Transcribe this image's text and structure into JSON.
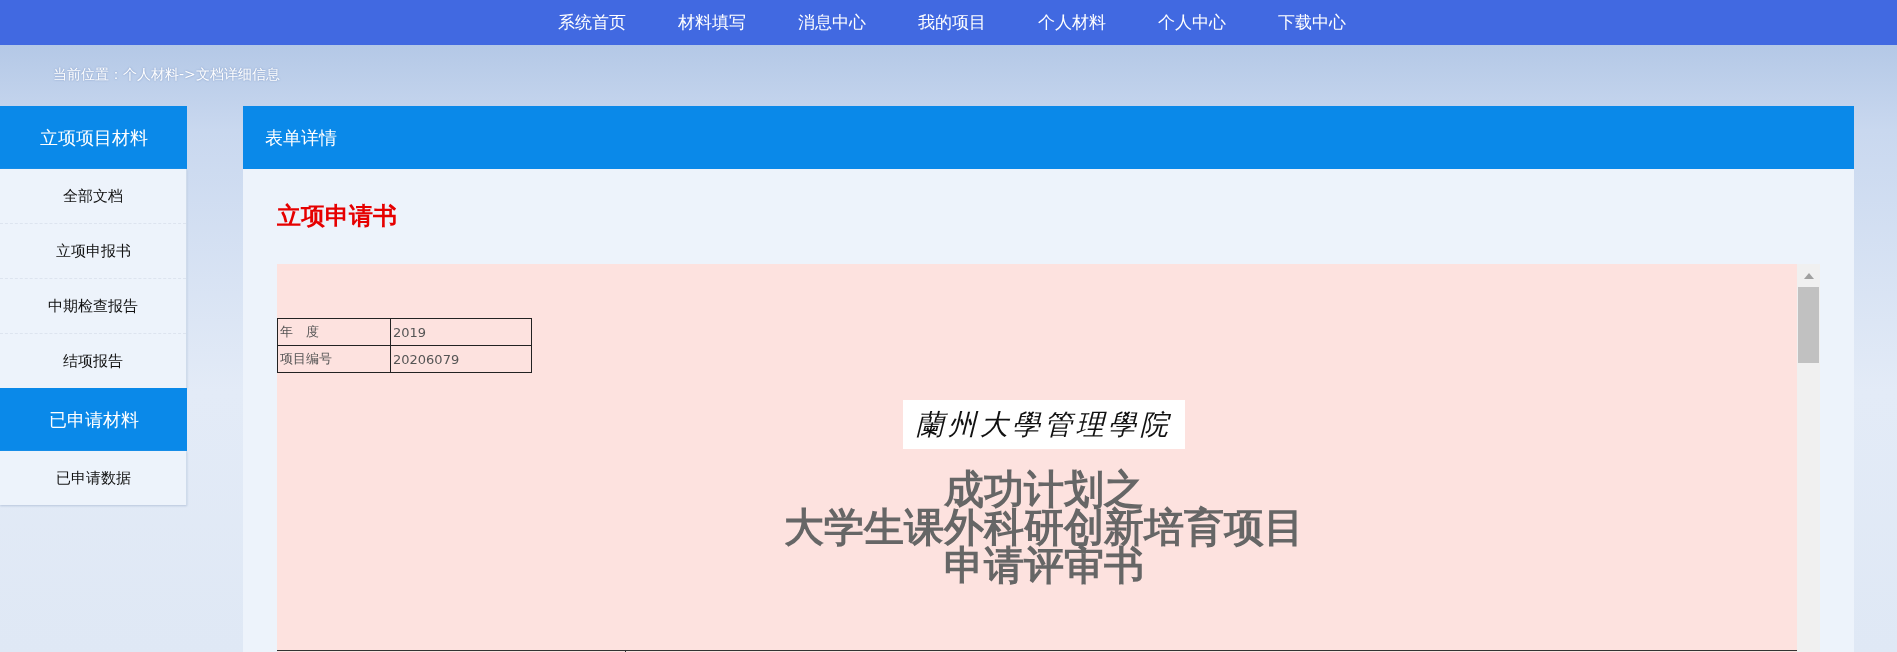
{
  "nav": {
    "items": [
      {
        "label": "系统首页"
      },
      {
        "label": "材料填写"
      },
      {
        "label": "消息中心"
      },
      {
        "label": "我的项目"
      },
      {
        "label": "个人材料"
      },
      {
        "label": "个人中心"
      },
      {
        "label": "下载中心"
      }
    ]
  },
  "breadcrumb": "当前位置：个人材料->文档详细信息",
  "sidebar": {
    "groups": [
      {
        "title": "立项项目材料",
        "items": [
          {
            "label": "全部文档"
          },
          {
            "label": "立项申报书"
          },
          {
            "label": "中期检查报告"
          },
          {
            "label": "结项报告"
          }
        ]
      },
      {
        "title": "已申请材料",
        "items": [
          {
            "label": "已申请数据"
          }
        ]
      }
    ]
  },
  "panel": {
    "title": "表单详情",
    "doc_title": "立项申请书",
    "document": {
      "info_rows": [
        {
          "label": "年　度",
          "value": "2019"
        },
        {
          "label": "项目编号",
          "value": "20206079"
        }
      ],
      "logo_text": "蘭州大學管理學院",
      "heading_lines": [
        "成功计划之",
        "大学生课外科研创新培育项目",
        "申请评审书"
      ]
    }
  }
}
